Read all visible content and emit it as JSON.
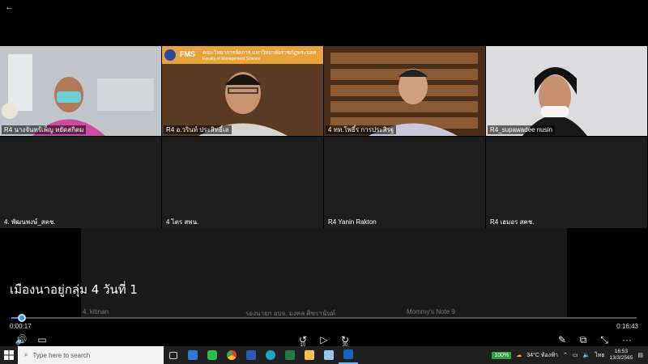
{
  "back_label": "←",
  "participants": [
    {
      "name": "R4 นางจันทร์เพ็ญ หยัดสกิดม"
    },
    {
      "name": "R4 อ.วรินท์ ประสิทธิ์เล"
    },
    {
      "name": "4 ทท.โพธิ์ร การประสิรฐ"
    },
    {
      "name": "R4_supawadee nusin"
    },
    {
      "name": "4. พัฒนพงษ์_สคช."
    },
    {
      "name": "4 ไตร สพน."
    },
    {
      "name": "R4 Yanin Rakton"
    },
    {
      "name": "R4 เฮมอร สคช."
    }
  ],
  "banner": {
    "org": "คณะวิทยาการจัดการ มหาวิทยาลัยราชภัฏพระนคร",
    "sub": "Faculty of Management Science",
    "logo": "FMS"
  },
  "caption": "เมืองนาอยู่กลุ่ม 4 วันที่ 1",
  "lower_names": [
    "4. kitinan",
    "รองนายก อบจ. มงคล ศิขรานันท์",
    "Mommy's Note 9"
  ],
  "player": {
    "current_time": "0:00:17",
    "total_time": "0:16:43",
    "progress": 0.017,
    "accent": "#3b8ee8"
  },
  "controls": {
    "volume": "🔊",
    "subtitles": "▭",
    "rewind_label": "10",
    "play": "▷",
    "forward_label": "30",
    "edit": "✎",
    "pip": "⧉",
    "fullscreen": "⤡",
    "more": "···"
  },
  "taskbar": {
    "search_placeholder": "Type here to search",
    "battery": "100%",
    "weather": "34°C ท้องฟ้า",
    "lang": "ไทย",
    "time": "16:53",
    "date": "13/3/2565"
  }
}
